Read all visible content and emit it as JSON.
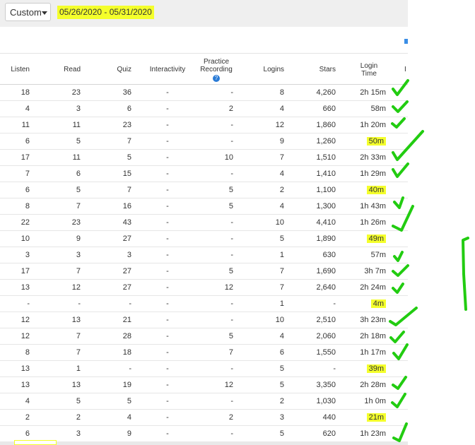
{
  "filter": {
    "range_select": "Custom",
    "date_range": "05/26/2020 - 05/31/2020"
  },
  "columns": {
    "listen": "Listen",
    "read": "Read",
    "quiz": "Quiz",
    "interactivity": "Interactivity",
    "practice_line1": "Practice",
    "practice_line2": "Recording",
    "logins": "Logins",
    "stars": "Stars",
    "login_time_line1": "Login",
    "login_time_line2": "Time",
    "partial_next": "I"
  },
  "rows": [
    {
      "listen": "18",
      "read": "23",
      "quiz": "36",
      "interactivity": "-",
      "practice": "-",
      "logins": "8",
      "stars": "4,260",
      "time": "2h 15m",
      "hl": false
    },
    {
      "listen": "4",
      "read": "3",
      "quiz": "6",
      "interactivity": "-",
      "practice": "2",
      "logins": "4",
      "stars": "660",
      "time": "58m",
      "hl": false
    },
    {
      "listen": "11",
      "read": "11",
      "quiz": "23",
      "interactivity": "-",
      "practice": "-",
      "logins": "12",
      "stars": "1,860",
      "time": "1h 20m",
      "hl": false
    },
    {
      "listen": "6",
      "read": "5",
      "quiz": "7",
      "interactivity": "-",
      "practice": "-",
      "logins": "9",
      "stars": "1,260",
      "time": "50m",
      "hl": true
    },
    {
      "listen": "17",
      "read": "11",
      "quiz": "5",
      "interactivity": "-",
      "practice": "10",
      "logins": "7",
      "stars": "1,510",
      "time": "2h 33m",
      "hl": false
    },
    {
      "listen": "7",
      "read": "6",
      "quiz": "15",
      "interactivity": "-",
      "practice": "-",
      "logins": "4",
      "stars": "1,410",
      "time": "1h 29m",
      "hl": false
    },
    {
      "listen": "6",
      "read": "5",
      "quiz": "7",
      "interactivity": "-",
      "practice": "5",
      "logins": "2",
      "stars": "1,100",
      "time": "40m",
      "hl": true
    },
    {
      "listen": "8",
      "read": "7",
      "quiz": "16",
      "interactivity": "-",
      "practice": "5",
      "logins": "4",
      "stars": "1,300",
      "time": "1h 43m",
      "hl": false
    },
    {
      "listen": "22",
      "read": "23",
      "quiz": "43",
      "interactivity": "-",
      "practice": "-",
      "logins": "10",
      "stars": "4,410",
      "time": "1h 26m",
      "hl": false
    },
    {
      "listen": "10",
      "read": "9",
      "quiz": "27",
      "interactivity": "-",
      "practice": "-",
      "logins": "5",
      "stars": "1,890",
      "time": "49m",
      "hl": true
    },
    {
      "listen": "3",
      "read": "3",
      "quiz": "3",
      "interactivity": "-",
      "practice": "-",
      "logins": "1",
      "stars": "630",
      "time": "57m",
      "hl": false
    },
    {
      "listen": "17",
      "read": "7",
      "quiz": "27",
      "interactivity": "-",
      "practice": "5",
      "logins": "7",
      "stars": "1,690",
      "time": "3h 7m",
      "hl": false
    },
    {
      "listen": "13",
      "read": "12",
      "quiz": "27",
      "interactivity": "-",
      "practice": "12",
      "logins": "7",
      "stars": "2,640",
      "time": "2h 24m",
      "hl": false
    },
    {
      "listen": "-",
      "read": "-",
      "quiz": "-",
      "interactivity": "-",
      "practice": "-",
      "logins": "1",
      "stars": "-",
      "time": "4m",
      "hl": true
    },
    {
      "listen": "12",
      "read": "13",
      "quiz": "21",
      "interactivity": "-",
      "practice": "-",
      "logins": "10",
      "stars": "2,510",
      "time": "3h 23m",
      "hl": false
    },
    {
      "listen": "12",
      "read": "7",
      "quiz": "28",
      "interactivity": "-",
      "practice": "5",
      "logins": "4",
      "stars": "2,060",
      "time": "2h 18m",
      "hl": false
    },
    {
      "listen": "8",
      "read": "7",
      "quiz": "18",
      "interactivity": "-",
      "practice": "7",
      "logins": "6",
      "stars": "1,550",
      "time": "1h 17m",
      "hl": false
    },
    {
      "listen": "13",
      "read": "1",
      "quiz": "-",
      "interactivity": "-",
      "practice": "-",
      "logins": "5",
      "stars": "-",
      "time": "39m",
      "hl": true
    },
    {
      "listen": "13",
      "read": "13",
      "quiz": "19",
      "interactivity": "-",
      "practice": "12",
      "logins": "5",
      "stars": "3,350",
      "time": "2h 28m",
      "hl": false
    },
    {
      "listen": "4",
      "read": "5",
      "quiz": "5",
      "interactivity": "-",
      "practice": "-",
      "logins": "2",
      "stars": "1,030",
      "time": "1h 0m",
      "hl": false
    },
    {
      "listen": "2",
      "read": "2",
      "quiz": "4",
      "interactivity": "-",
      "practice": "2",
      "logins": "3",
      "stars": "440",
      "time": "21m",
      "hl": true
    },
    {
      "listen": "6",
      "read": "3",
      "quiz": "9",
      "interactivity": "-",
      "practice": "-",
      "logins": "5",
      "stars": "620",
      "time": "1h 23m",
      "hl": false
    }
  ],
  "colors": {
    "highlight": "#f4ff2b",
    "checkmark": "#22cc11",
    "help_icon": "#2a7bd6"
  }
}
